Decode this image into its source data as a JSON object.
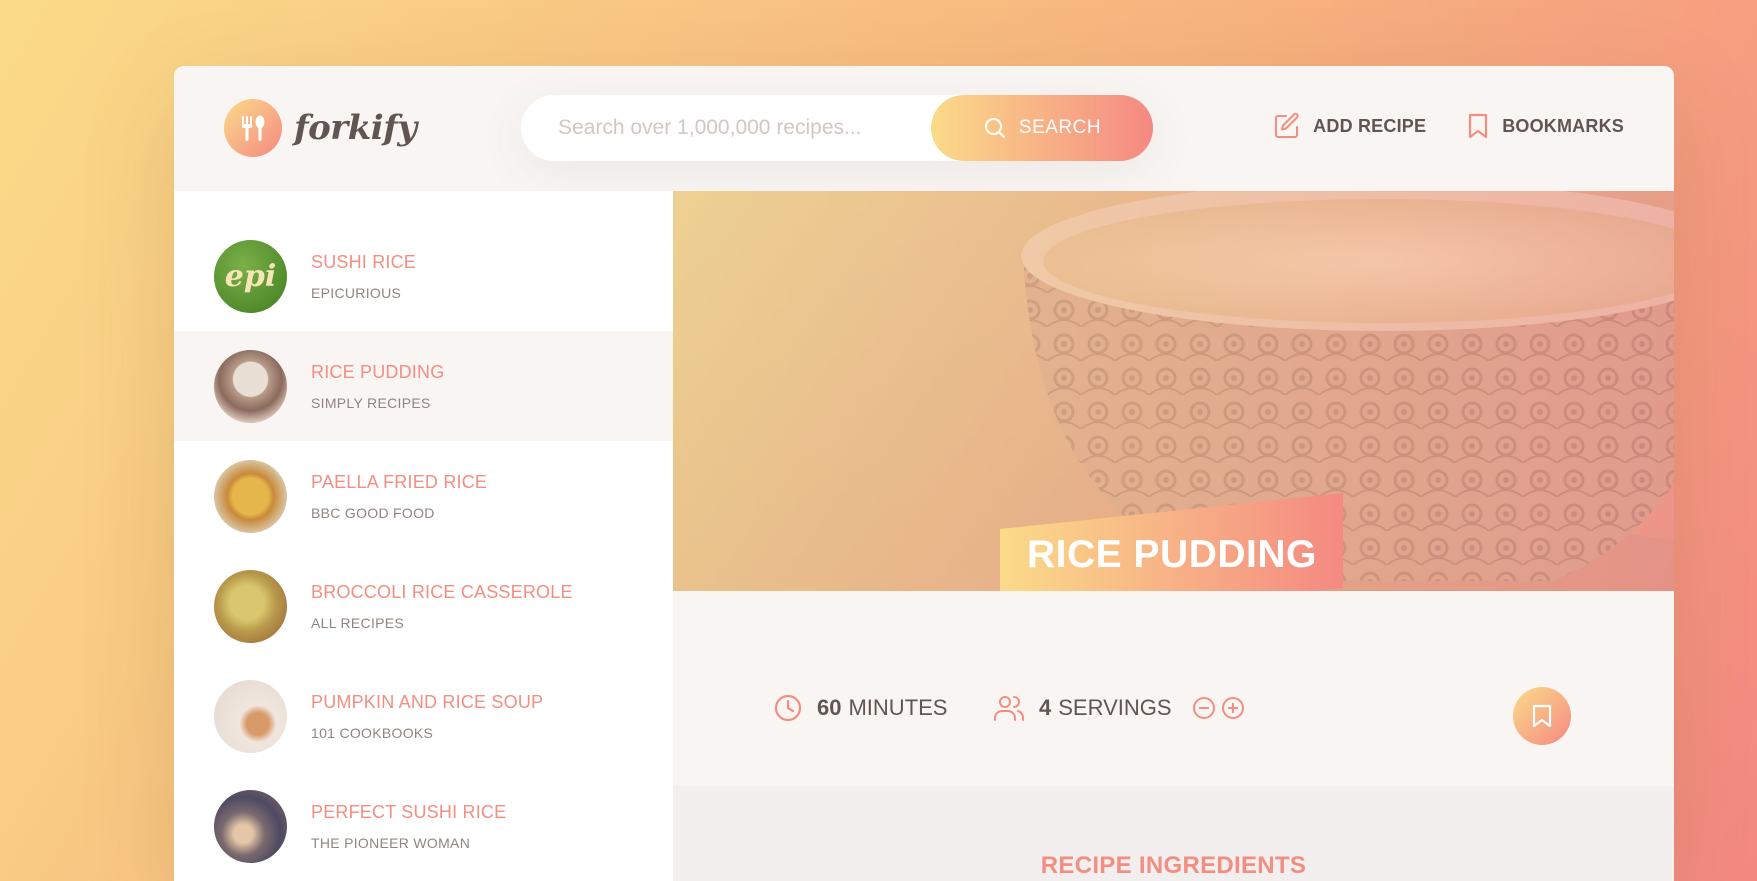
{
  "header": {
    "logo_text": "forkify",
    "search_placeholder": "Search over 1,000,000 recipes...",
    "search_button": "SEARCH",
    "nav": {
      "add_recipe": "ADD RECIPE",
      "bookmarks": "BOOKMARKS"
    }
  },
  "results": [
    {
      "title": "SUSHI RICE",
      "publisher": "EPICURIOUS",
      "thumb_label": "epi"
    },
    {
      "title": "RICE PUDDING",
      "publisher": "SIMPLY RECIPES"
    },
    {
      "title": "PAELLA FRIED RICE",
      "publisher": "BBC GOOD FOOD"
    },
    {
      "title": "BROCCOLI RICE CASSEROLE",
      "publisher": "ALL RECIPES"
    },
    {
      "title": "PUMPKIN AND RICE SOUP",
      "publisher": "101 COOKBOOKS"
    },
    {
      "title": "PERFECT SUSHI RICE",
      "publisher": "THE PIONEER WOMAN"
    }
  ],
  "recipe": {
    "title": "RICE PUDDING",
    "minutes_value": "60",
    "minutes_label": "MINUTES",
    "servings_value": "4",
    "servings_label": "SERVINGS",
    "ingredients_heading": "RECIPE INGREDIENTS"
  },
  "colors": {
    "accent": "#f38e82",
    "gradient_start": "#fbdb89",
    "gradient_end": "#f48982",
    "text": "#615551"
  }
}
